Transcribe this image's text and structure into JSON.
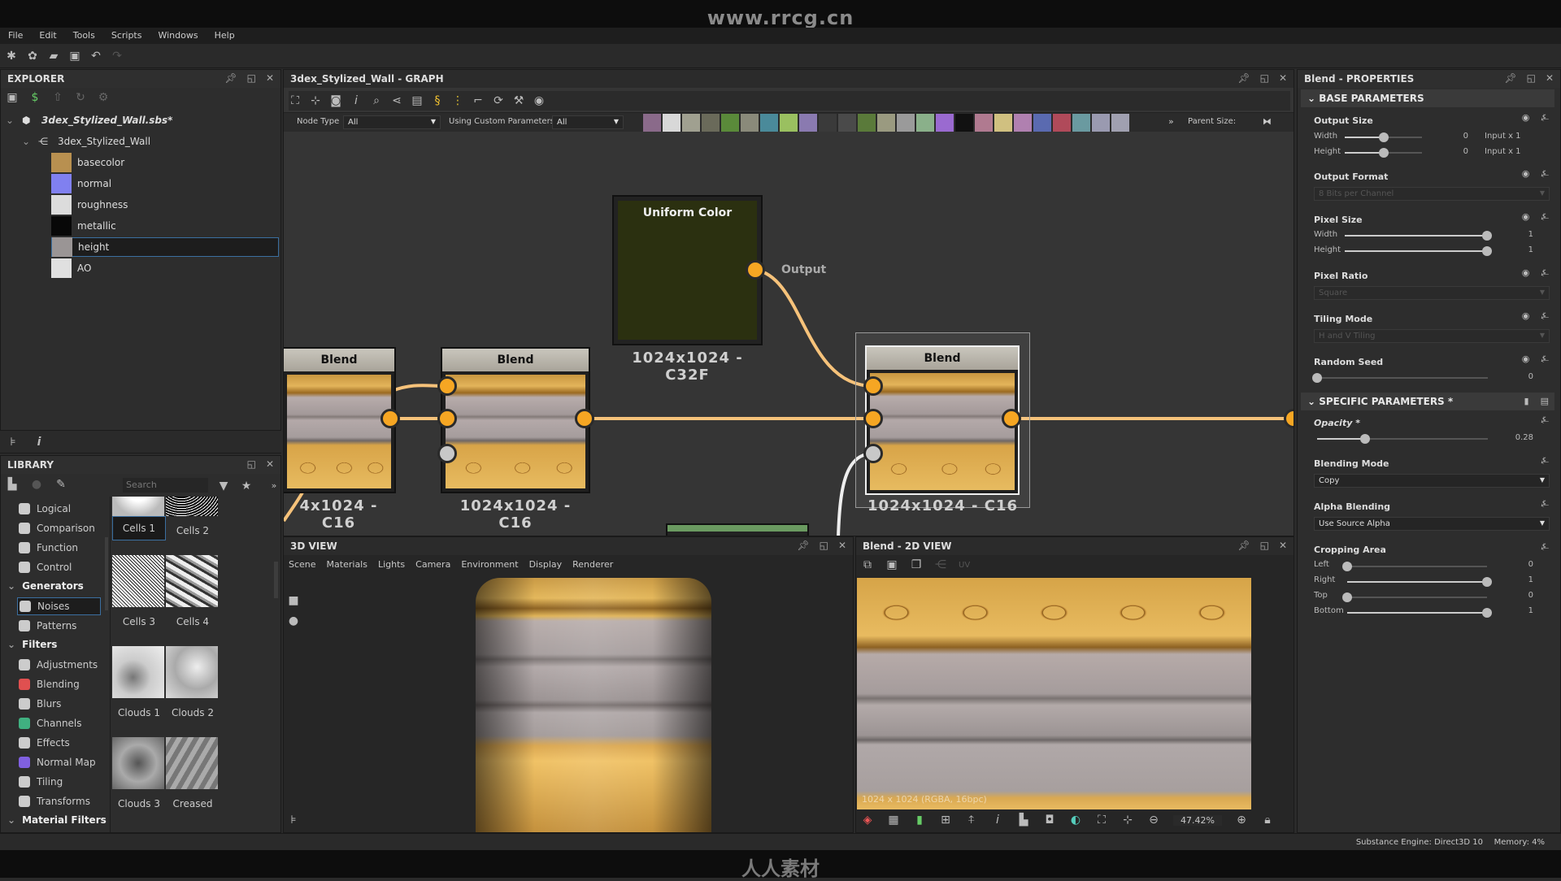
{
  "watermark": {
    "top": "www.rrcg.cn",
    "bottom": "人人素材"
  },
  "menu": [
    "File",
    "Edit",
    "Tools",
    "Scripts",
    "Windows",
    "Help"
  ],
  "explorer": {
    "title": "EXPLORER",
    "package": "3dex_Stylized_Wall.sbs*",
    "graph": "3dex_Stylized_Wall",
    "outputs": [
      {
        "label": "basecolor",
        "color": "#b89050"
      },
      {
        "label": "normal",
        "color": "#8080f0"
      },
      {
        "label": "roughness",
        "color": "#dcdcdc"
      },
      {
        "label": "metallic",
        "color": "#080808"
      },
      {
        "label": "height",
        "color": "#9a9595",
        "selected": true
      },
      {
        "label": "AO",
        "color": "#e0e0e0"
      }
    ]
  },
  "library": {
    "title": "LIBRARY",
    "search_placeholder": "Search",
    "categories": [
      {
        "label": "Logical",
        "type": "item"
      },
      {
        "label": "Comparison",
        "type": "item"
      },
      {
        "label": "Function",
        "type": "item"
      },
      {
        "label": "Control",
        "type": "item"
      },
      {
        "label": "Generators",
        "type": "group"
      },
      {
        "label": "Noises",
        "type": "item",
        "selected": true
      },
      {
        "label": "Patterns",
        "type": "item"
      },
      {
        "label": "Filters",
        "type": "group"
      },
      {
        "label": "Adjustments",
        "type": "item"
      },
      {
        "label": "Blending",
        "type": "item"
      },
      {
        "label": "Blurs",
        "type": "item"
      },
      {
        "label": "Channels",
        "type": "item"
      },
      {
        "label": "Effects",
        "type": "item"
      },
      {
        "label": "Normal Map",
        "type": "item"
      },
      {
        "label": "Tiling",
        "type": "item"
      },
      {
        "label": "Transforms",
        "type": "item"
      },
      {
        "label": "Material Filters",
        "type": "group"
      }
    ],
    "thumbnails": [
      {
        "label": "Cells 1",
        "selected": true
      },
      {
        "label": "Cells 2"
      },
      {
        "label": "Cells 3"
      },
      {
        "label": "Cells 4"
      },
      {
        "label": "Clouds 1"
      },
      {
        "label": "Clouds 2"
      },
      {
        "label": "Clouds 3"
      },
      {
        "label": "Creased"
      }
    ]
  },
  "graph": {
    "title": "3dex_Stylized_Wall - GRAPH",
    "node_type_label": "Node Type",
    "node_type_value": "All",
    "custom_params_label": "Using Custom Parameters",
    "custom_params_value": "All",
    "parent_size_label": "Parent Size:",
    "node_palette": [
      "#8a6a8a",
      "#d8d8d8",
      "#a0a090",
      "#6a6a5a",
      "#5a8a3a",
      "#8a8a7a",
      "#4a8a9a",
      "#9ac060",
      "#8a7ab0",
      "#3a3a3a",
      "#4a4a4a",
      "#5a7a3a",
      "#9a9a80",
      "#9a9a9a",
      "#8ab08a",
      "#9a6ad0",
      "#111111",
      "#b07a90",
      "#d0c080",
      "#b080b0",
      "#5a6ab0",
      "#b04a5a",
      "#6a9aa0",
      "#9a9ab0",
      "#a0a0b0"
    ],
    "nodes": {
      "uniform": {
        "title": "Uniform Color",
        "port": "Output",
        "size": "1024x1024 - C32F",
        "color": "#2b3010"
      },
      "blend_left": {
        "title": "Blend",
        "size": "4x1024 - C16"
      },
      "blend_mid": {
        "title": "Blend",
        "size": "1024x1024 - C16"
      },
      "blend_right": {
        "title": "Blend",
        "size": "1024x1024 - C16"
      }
    },
    "link_color": "#f6a623"
  },
  "view3d": {
    "title": "3D VIEW",
    "menu": [
      "Scene",
      "Materials",
      "Lights",
      "Camera",
      "Environment",
      "Display",
      "Renderer"
    ]
  },
  "view2d": {
    "title": "Blend - 2D VIEW",
    "uv_label": "UV",
    "image_info": "1024 x 1024 (RGBA, 16bpc)",
    "zoom": "47.42%"
  },
  "properties": {
    "title": "Blend - PROPERTIES",
    "base_section": "BASE PARAMETERS",
    "output_size": {
      "label": "Output Size",
      "width_label": "Width",
      "height_label": "Height",
      "width_value": "0",
      "height_value": "0",
      "width_mode": "Input x 1",
      "height_mode": "Input x 1"
    },
    "output_format": {
      "label": "Output Format",
      "value": "8 Bits per Channel"
    },
    "pixel_size": {
      "label": "Pixel Size",
      "width_label": "Width",
      "height_label": "Height",
      "width_value": "1",
      "height_value": "1"
    },
    "pixel_ratio": {
      "label": "Pixel Ratio",
      "value": "Square"
    },
    "tiling_mode": {
      "label": "Tiling Mode",
      "value": "H and V Tiling"
    },
    "random_seed": {
      "label": "Random Seed",
      "value": "0"
    },
    "specific_section": "SPECIFIC PARAMETERS *",
    "opacity": {
      "label": "Opacity *",
      "value": "0.28",
      "fraction": 0.28
    },
    "blending_mode": {
      "label": "Blending Mode",
      "value": "Copy"
    },
    "alpha_blending": {
      "label": "Alpha Blending",
      "value": "Use Source Alpha"
    },
    "cropping": {
      "label": "Cropping Area",
      "left_label": "Left",
      "right_label": "Right",
      "top_label": "Top",
      "bottom_label": "Bottom",
      "left": "0",
      "right": "1",
      "top": "0",
      "bottom": "1"
    }
  },
  "status": {
    "engine": "Substance Engine: Direct3D 10",
    "memory": "Memory: 4%"
  }
}
